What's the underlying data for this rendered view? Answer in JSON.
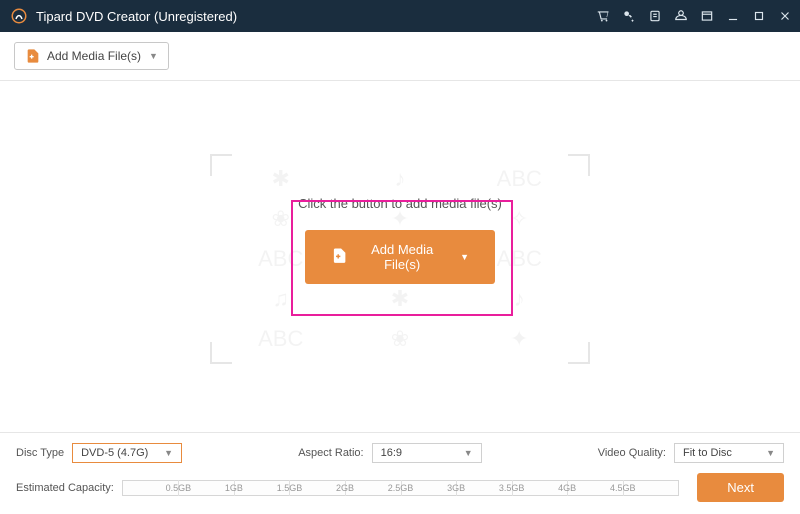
{
  "titlebar": {
    "title": "Tipard DVD Creator (Unregistered)"
  },
  "toolbar": {
    "add_label": "Add Media File(s)"
  },
  "main": {
    "instruction": "Click the button to add media file(s)",
    "add_label": "Add Media File(s)"
  },
  "footer": {
    "disc_type_label": "Disc Type",
    "disc_type_value": "DVD-5 (4.7G)",
    "aspect_label": "Aspect Ratio:",
    "aspect_value": "16:9",
    "quality_label": "Video Quality:",
    "quality_value": "Fit to Disc",
    "capacity_label": "Estimated Capacity:",
    "next_label": "Next",
    "ticks": [
      "0.5GB",
      "1GB",
      "1.5GB",
      "2GB",
      "2.5GB",
      "3GB",
      "3.5GB",
      "4GB",
      "4.5GB"
    ]
  },
  "colors": {
    "accent": "#e88b3e",
    "highlight": "#e91e9c",
    "titlebar": "#1a2d3e"
  }
}
